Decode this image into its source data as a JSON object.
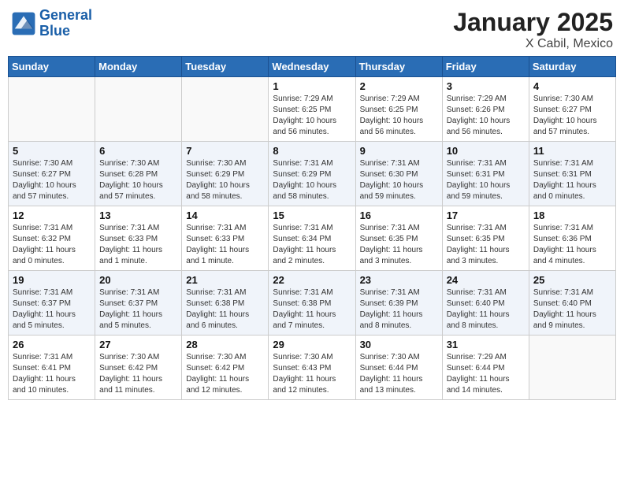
{
  "header": {
    "logo_line1": "General",
    "logo_line2": "Blue",
    "month": "January 2025",
    "location": "X Cabil, Mexico"
  },
  "weekdays": [
    "Sunday",
    "Monday",
    "Tuesday",
    "Wednesday",
    "Thursday",
    "Friday",
    "Saturday"
  ],
  "weeks": [
    [
      {
        "day": "",
        "info": ""
      },
      {
        "day": "",
        "info": ""
      },
      {
        "day": "",
        "info": ""
      },
      {
        "day": "1",
        "info": "Sunrise: 7:29 AM\nSunset: 6:25 PM\nDaylight: 10 hours\nand 56 minutes."
      },
      {
        "day": "2",
        "info": "Sunrise: 7:29 AM\nSunset: 6:25 PM\nDaylight: 10 hours\nand 56 minutes."
      },
      {
        "day": "3",
        "info": "Sunrise: 7:29 AM\nSunset: 6:26 PM\nDaylight: 10 hours\nand 56 minutes."
      },
      {
        "day": "4",
        "info": "Sunrise: 7:30 AM\nSunset: 6:27 PM\nDaylight: 10 hours\nand 57 minutes."
      }
    ],
    [
      {
        "day": "5",
        "info": "Sunrise: 7:30 AM\nSunset: 6:27 PM\nDaylight: 10 hours\nand 57 minutes."
      },
      {
        "day": "6",
        "info": "Sunrise: 7:30 AM\nSunset: 6:28 PM\nDaylight: 10 hours\nand 57 minutes."
      },
      {
        "day": "7",
        "info": "Sunrise: 7:30 AM\nSunset: 6:29 PM\nDaylight: 10 hours\nand 58 minutes."
      },
      {
        "day": "8",
        "info": "Sunrise: 7:31 AM\nSunset: 6:29 PM\nDaylight: 10 hours\nand 58 minutes."
      },
      {
        "day": "9",
        "info": "Sunrise: 7:31 AM\nSunset: 6:30 PM\nDaylight: 10 hours\nand 59 minutes."
      },
      {
        "day": "10",
        "info": "Sunrise: 7:31 AM\nSunset: 6:31 PM\nDaylight: 10 hours\nand 59 minutes."
      },
      {
        "day": "11",
        "info": "Sunrise: 7:31 AM\nSunset: 6:31 PM\nDaylight: 11 hours\nand 0 minutes."
      }
    ],
    [
      {
        "day": "12",
        "info": "Sunrise: 7:31 AM\nSunset: 6:32 PM\nDaylight: 11 hours\nand 0 minutes."
      },
      {
        "day": "13",
        "info": "Sunrise: 7:31 AM\nSunset: 6:33 PM\nDaylight: 11 hours\nand 1 minute."
      },
      {
        "day": "14",
        "info": "Sunrise: 7:31 AM\nSunset: 6:33 PM\nDaylight: 11 hours\nand 1 minute."
      },
      {
        "day": "15",
        "info": "Sunrise: 7:31 AM\nSunset: 6:34 PM\nDaylight: 11 hours\nand 2 minutes."
      },
      {
        "day": "16",
        "info": "Sunrise: 7:31 AM\nSunset: 6:35 PM\nDaylight: 11 hours\nand 3 minutes."
      },
      {
        "day": "17",
        "info": "Sunrise: 7:31 AM\nSunset: 6:35 PM\nDaylight: 11 hours\nand 3 minutes."
      },
      {
        "day": "18",
        "info": "Sunrise: 7:31 AM\nSunset: 6:36 PM\nDaylight: 11 hours\nand 4 minutes."
      }
    ],
    [
      {
        "day": "19",
        "info": "Sunrise: 7:31 AM\nSunset: 6:37 PM\nDaylight: 11 hours\nand 5 minutes."
      },
      {
        "day": "20",
        "info": "Sunrise: 7:31 AM\nSunset: 6:37 PM\nDaylight: 11 hours\nand 5 minutes."
      },
      {
        "day": "21",
        "info": "Sunrise: 7:31 AM\nSunset: 6:38 PM\nDaylight: 11 hours\nand 6 minutes."
      },
      {
        "day": "22",
        "info": "Sunrise: 7:31 AM\nSunset: 6:38 PM\nDaylight: 11 hours\nand 7 minutes."
      },
      {
        "day": "23",
        "info": "Sunrise: 7:31 AM\nSunset: 6:39 PM\nDaylight: 11 hours\nand 8 minutes."
      },
      {
        "day": "24",
        "info": "Sunrise: 7:31 AM\nSunset: 6:40 PM\nDaylight: 11 hours\nand 8 minutes."
      },
      {
        "day": "25",
        "info": "Sunrise: 7:31 AM\nSunset: 6:40 PM\nDaylight: 11 hours\nand 9 minutes."
      }
    ],
    [
      {
        "day": "26",
        "info": "Sunrise: 7:31 AM\nSunset: 6:41 PM\nDaylight: 11 hours\nand 10 minutes."
      },
      {
        "day": "27",
        "info": "Sunrise: 7:30 AM\nSunset: 6:42 PM\nDaylight: 11 hours\nand 11 minutes."
      },
      {
        "day": "28",
        "info": "Sunrise: 7:30 AM\nSunset: 6:42 PM\nDaylight: 11 hours\nand 12 minutes."
      },
      {
        "day": "29",
        "info": "Sunrise: 7:30 AM\nSunset: 6:43 PM\nDaylight: 11 hours\nand 12 minutes."
      },
      {
        "day": "30",
        "info": "Sunrise: 7:30 AM\nSunset: 6:44 PM\nDaylight: 11 hours\nand 13 minutes."
      },
      {
        "day": "31",
        "info": "Sunrise: 7:29 AM\nSunset: 6:44 PM\nDaylight: 11 hours\nand 14 minutes."
      },
      {
        "day": "",
        "info": ""
      }
    ]
  ]
}
